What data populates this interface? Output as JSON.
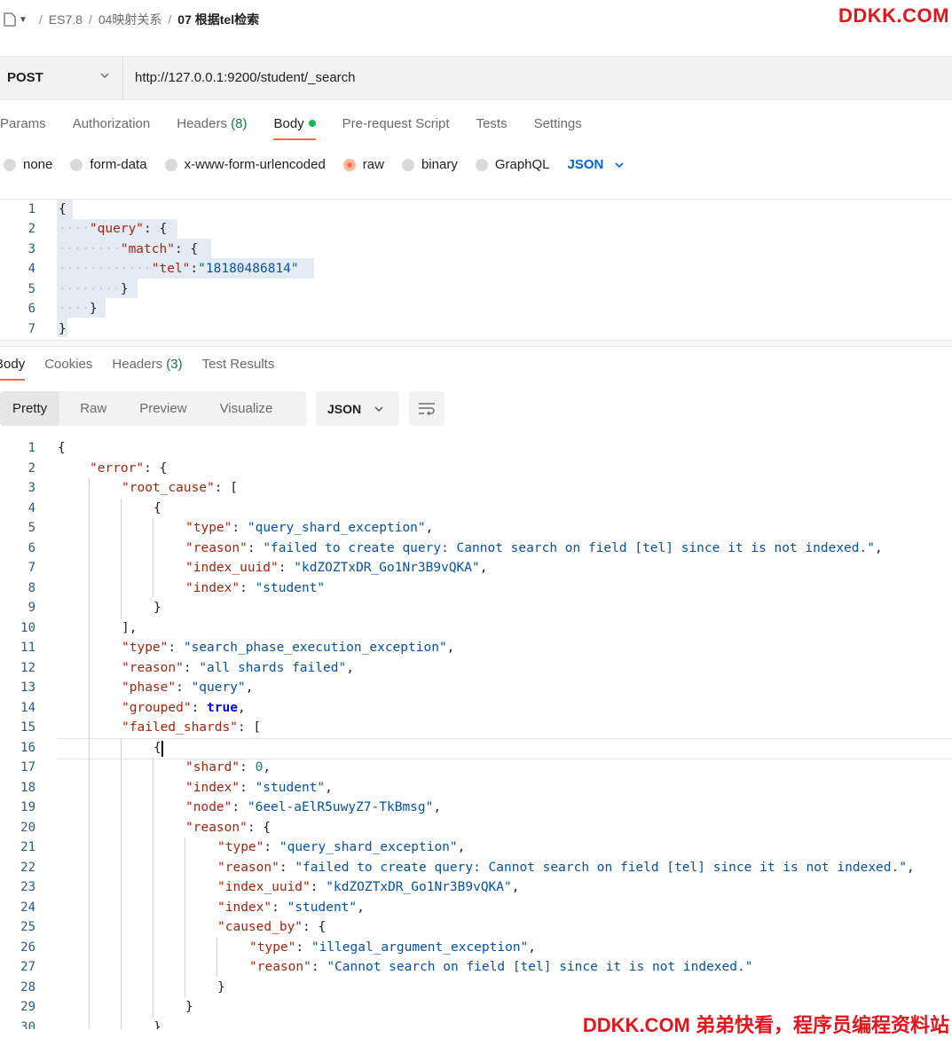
{
  "breadcrumb": {
    "items": [
      "ES7.8",
      "04映射关系"
    ],
    "current": "07 根据tel检索"
  },
  "watermark": {
    "top": "DDKK.COM",
    "bottom": "DDKK.COM 弟弟快看，程序员编程资料站"
  },
  "request": {
    "method": "POST",
    "url": "http://127.0.0.1:9200/student/_search"
  },
  "request_tabs": {
    "params": "Params",
    "authorization": "Authorization",
    "headers": "Headers",
    "headers_count": "(8)",
    "body": "Body",
    "prerequest": "Pre-request Script",
    "tests": "Tests",
    "settings": "Settings"
  },
  "body_types": {
    "none": "none",
    "form_data": "form-data",
    "urlencoded": "x-www-form-urlencoded",
    "raw": "raw",
    "binary": "binary",
    "graphql": "GraphQL",
    "format": "JSON",
    "selected": "raw"
  },
  "request_body": {
    "line_numbers": [
      "1",
      "2",
      "3",
      "4",
      "5",
      "6",
      "7"
    ],
    "tel_value": "\"18180486814\""
  },
  "response_tabs": {
    "body": "Body",
    "cookies": "Cookies",
    "headers": "Headers",
    "headers_count": "(3)",
    "test_results": "Test Results"
  },
  "view_modes": {
    "pretty": "Pretty",
    "raw": "Raw",
    "preview": "Preview",
    "visualize": "Visualize",
    "format": "JSON"
  },
  "response": {
    "index_uuid": "kdZOZTxDR_Go1Nr3B9vQKA",
    "index": "student",
    "node": "6eel-aElR5uwyZ7-TkBmsg",
    "reason_shard": "failed to create query: Cannot search on field [tel] since it is not indexed.",
    "reason_top": "all shards failed",
    "reason_caused": "Cannot search on field [tel] since it is not indexed.",
    "type_shard": "query_shard_exception",
    "type_top": "search_phase_execution_exception",
    "type_caused": "illegal_argument_exception",
    "phase": "query",
    "grouped": "true",
    "shard": "0"
  },
  "colors": {
    "accent": "#ff6c37",
    "json_key": "#a1260d",
    "json_string": "#0451a5",
    "json_number": "#098658",
    "json_bool": "#0000ff",
    "line_number": "#2a5a8a",
    "link_blue": "#0265d2",
    "watermark": "#e0161c"
  }
}
